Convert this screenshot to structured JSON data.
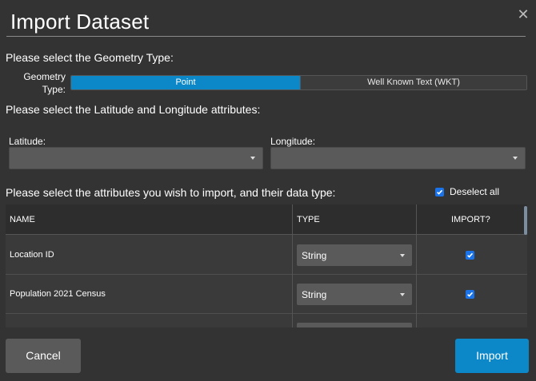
{
  "dialog": {
    "title": "Import Dataset",
    "close_icon": "close-icon"
  },
  "geometry": {
    "prompt": "Please select the Geometry Type:",
    "label": "Geometry Type:",
    "options": [
      "Point",
      "Well Known Text (WKT)"
    ],
    "selected": "Point"
  },
  "latlon": {
    "prompt": "Please select the Latitude and Longitude attributes:",
    "latitude_label": "Latitude:",
    "latitude_value": "",
    "longitude_label": "Longitude:",
    "longitude_value": ""
  },
  "attributes": {
    "prompt": "Please select the attributes you wish to import, and their data type:",
    "deselect_label": "Deselect all",
    "deselect_checked": true,
    "columns": [
      "NAME",
      "TYPE",
      "IMPORT?"
    ],
    "rows": [
      {
        "name": "Location ID",
        "type": "String",
        "import": true
      },
      {
        "name": "Population 2021 Census",
        "type": "String",
        "import": true
      }
    ]
  },
  "footer": {
    "cancel_label": "Cancel",
    "import_label": "Import"
  },
  "colors": {
    "accent": "#0c88c8",
    "background": "#333333",
    "checkbox": "#1a73e8"
  }
}
